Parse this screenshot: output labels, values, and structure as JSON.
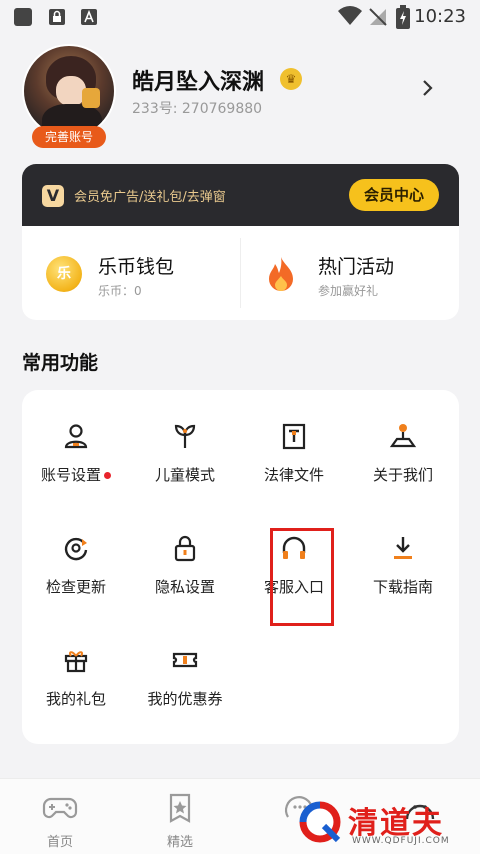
{
  "status_bar": {
    "time": "10:23"
  },
  "profile": {
    "username": "皓月坠入深渊",
    "user_id": "233号: 270769880",
    "complete_badge": "完善账号"
  },
  "vip": {
    "logo": "V",
    "text": "会员免广告/送礼包/去弹窗",
    "button": "会员中心"
  },
  "wallet": {
    "icon_text": "乐",
    "title": "乐币钱包",
    "sub": "乐币：0"
  },
  "activity": {
    "title": "热门活动",
    "sub": "参加赢好礼"
  },
  "functions": {
    "title": "常用功能",
    "items": [
      {
        "label": "账号设置"
      },
      {
        "label": "儿童模式"
      },
      {
        "label": "法律文件"
      },
      {
        "label": "关于我们"
      },
      {
        "label": "检查更新"
      },
      {
        "label": "隐私设置"
      },
      {
        "label": "客服入口"
      },
      {
        "label": "下载指南"
      },
      {
        "label": "我的礼包"
      },
      {
        "label": "我的优惠券"
      }
    ]
  },
  "tabs": [
    {
      "label": "首页"
    },
    {
      "label": "精选"
    }
  ],
  "watermark": {
    "text": "清道夫",
    "url": "WWW.QDFUJI.COM"
  },
  "colors": {
    "accent": "#f6c11c",
    "vip_bg": "#2a2a2e",
    "icon_orange": "#f0801c",
    "highlight": "#e0201b"
  }
}
